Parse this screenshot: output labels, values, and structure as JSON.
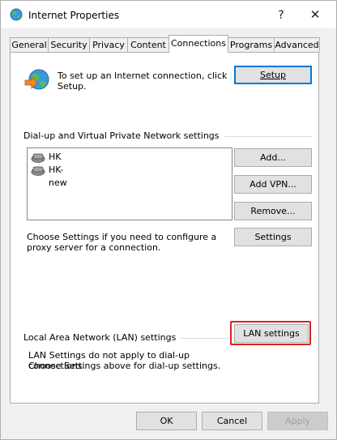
{
  "window": {
    "title": "Internet Properties",
    "help": "?",
    "close": "✕"
  },
  "tabs": [
    {
      "label": "General"
    },
    {
      "label": "Security"
    },
    {
      "label": "Privacy"
    },
    {
      "label": "Content"
    },
    {
      "label": "Connections",
      "active": true
    },
    {
      "label": "Programs"
    },
    {
      "label": "Advanced"
    }
  ],
  "setup": {
    "text": "To set up an Internet connection, click Setup.",
    "button": "Setup"
  },
  "dialup": {
    "group_label": "Dial-up and Virtual Private Network settings",
    "connections": [
      "HK",
      "HK-new"
    ],
    "add_button": "Add...",
    "add_vpn_button": "Add VPN...",
    "remove_button": "Remove...",
    "proxy_text": "Choose Settings if you need to configure a proxy server for a connection.",
    "settings_button": "Settings"
  },
  "lan": {
    "group_label": "Local Area Network (LAN) settings",
    "text_line1": "LAN Settings do not apply to dial-up connections.",
    "text_line2": "Choose Settings above for dial-up settings.",
    "button": "LAN settings"
  },
  "footer": {
    "ok": "OK",
    "cancel": "Cancel",
    "apply": "Apply"
  }
}
